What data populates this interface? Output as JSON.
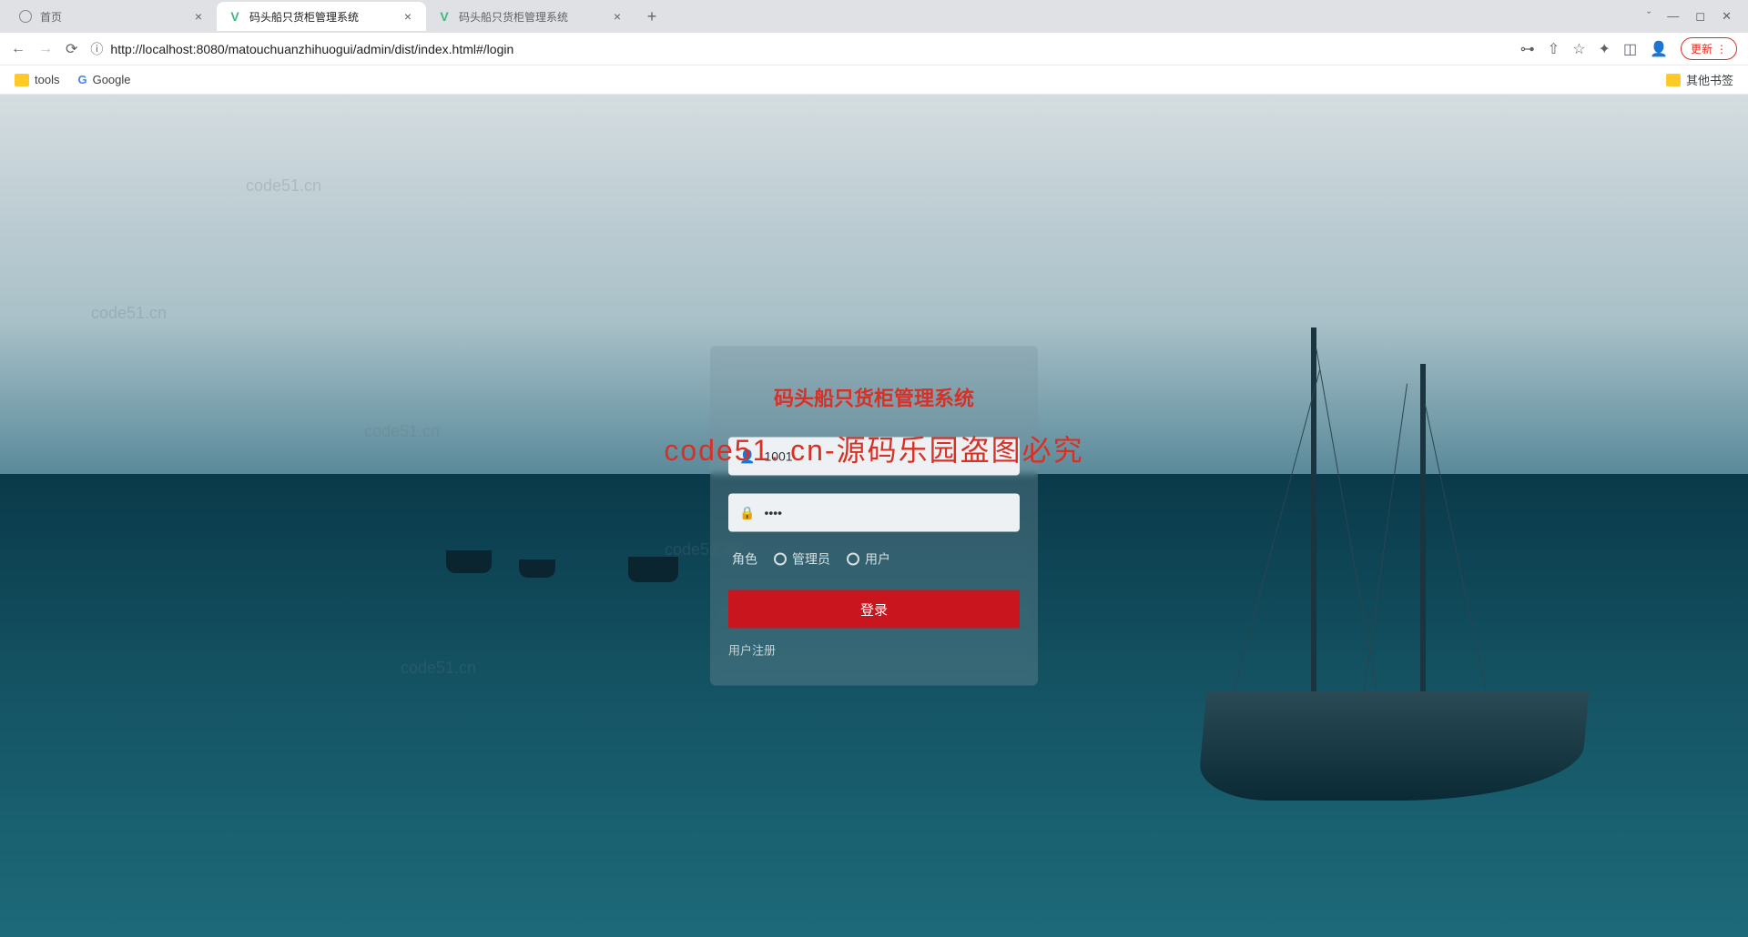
{
  "browser": {
    "tabs": [
      {
        "title": "首页",
        "icon": "globe",
        "active": false
      },
      {
        "title": "码头船只货柜管理系统",
        "icon": "vue",
        "active": true
      },
      {
        "title": "码头船只货柜管理系统",
        "icon": "vue",
        "active": false
      }
    ],
    "url": "http://localhost:8080/matouchuanzhihuogui/admin/dist/index.html#/login",
    "update_label": "更新",
    "bookmarks": {
      "tools": "tools",
      "google": "Google",
      "other": "其他书签"
    }
  },
  "login": {
    "title": "码头船只货柜管理系统",
    "username_value": "1001",
    "password_value": "••••",
    "role_label": "角色",
    "role_admin": "管理员",
    "role_user": "用户",
    "login_button": "登录",
    "register_link": "用户注册"
  },
  "watermarks": {
    "main": "code51. cn-源码乐园盗图必究",
    "small": "code51.cn"
  }
}
